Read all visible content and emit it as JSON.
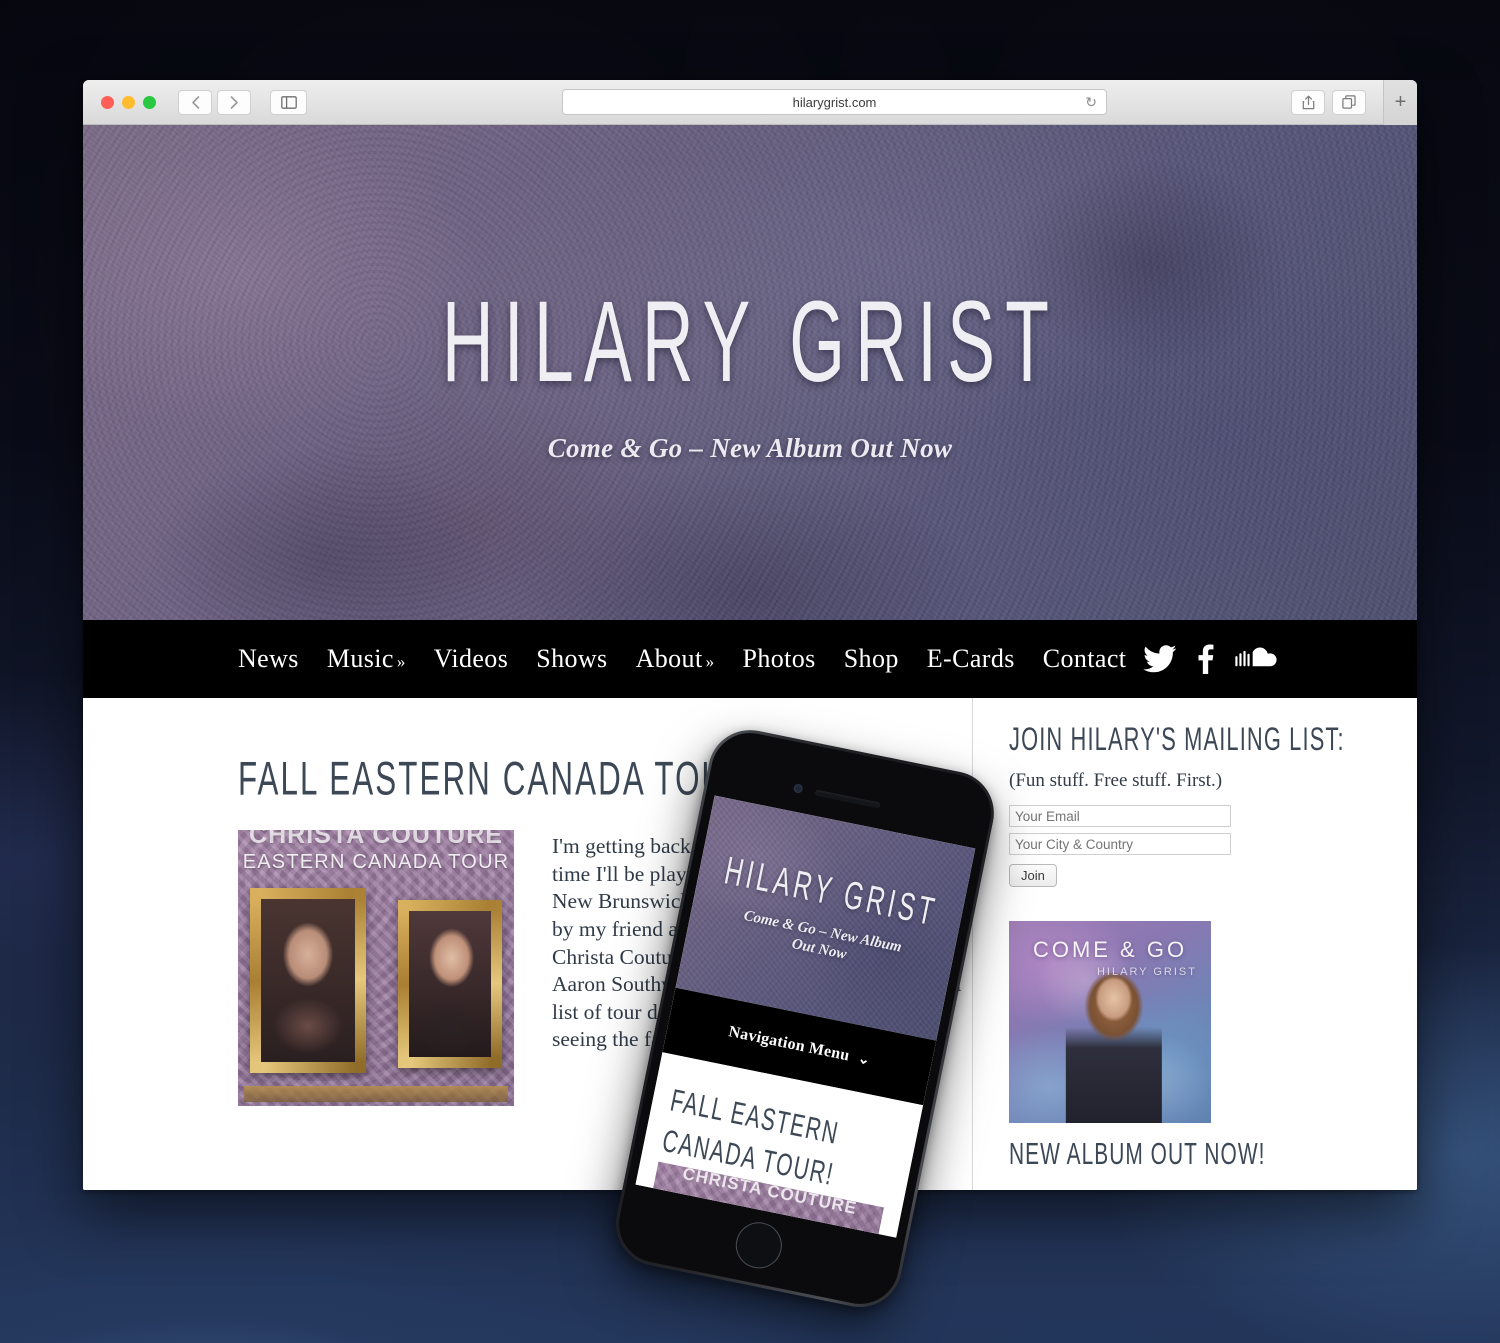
{
  "browser": {
    "url": "hilarygrist.com",
    "reload_icon": "↻",
    "back_icon": "‹",
    "forward_icon": "›",
    "sidebar_icon": "sidebar-toggle",
    "share_icon": "share",
    "tabs_icon": "show-tabs",
    "new_tab_label": "+"
  },
  "site": {
    "title": "HILARY GRIST",
    "tagline": "Come & Go – New Album Out Now"
  },
  "nav": {
    "items": [
      {
        "label": "News",
        "caret": ""
      },
      {
        "label": "Music",
        "caret": "»"
      },
      {
        "label": "Videos",
        "caret": ""
      },
      {
        "label": "Shows",
        "caret": ""
      },
      {
        "label": "About",
        "caret": "»"
      },
      {
        "label": "Photos",
        "caret": ""
      },
      {
        "label": "Shop",
        "caret": ""
      },
      {
        "label": "E-Cards",
        "caret": ""
      },
      {
        "label": "Contact",
        "caret": ""
      }
    ],
    "social": [
      "twitter-icon",
      "facebook-icon",
      "soundcloud-icon"
    ]
  },
  "post": {
    "title": "FALL EASTERN CANADA TOUR!",
    "body": "I'm getting back on the road this October! This time I'll be playing shows in Ontario, Quebec, New Brunswick and Nova Scotia. I'll be joined by my friend and fellow singer-songwriter Christa Couture, as well as my hus-Band-mate Aaron Southworth of course. Check out the full list of tour dates below. I'm looking forward to seeing the fall colours in all their glory!",
    "poster": {
      "names": "CHRISTA COUTURE",
      "subtitle": "EASTERN CANADA TOUR"
    }
  },
  "sidebar": {
    "mailing_title": "JOIN HILARY'S MAILING LIST:",
    "mailing_subtitle": "(Fun stuff. Free stuff. First.)",
    "email_placeholder": "Your Email",
    "city_placeholder": "Your City & Country",
    "join_label": "Join",
    "album": {
      "title": "COME & GO",
      "artist": "HILARY\nGRIST",
      "caption": "NEW ALBUM OUT NOW!"
    }
  },
  "phone": {
    "title": "HILARY GRIST",
    "tagline": "Come & Go – New Album Out Now",
    "nav_label": "Navigation Menu",
    "nav_chevron": "⌄",
    "post_title": "FALL EASTERN CANADA TOUR!",
    "thumb_text": "CHRISTA COUTURE"
  },
  "colors": {
    "nav_background": "#000000",
    "hero_purple": "#6f6384",
    "text_blue_grey": "#3c4856",
    "page_background": "#ffffff",
    "desktop_background": "#12182c"
  }
}
